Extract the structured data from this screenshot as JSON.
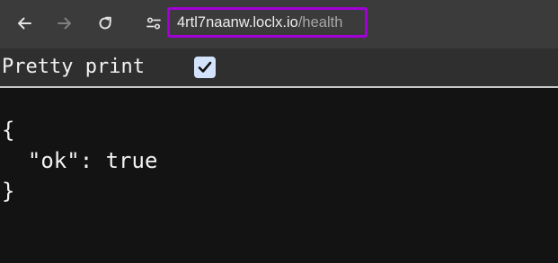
{
  "browser": {
    "url_host": "4rtl7naanw.loclx.io",
    "url_path": "/health",
    "back_icon": "arrow-left",
    "forward_icon": "arrow-right",
    "reload_icon": "reload",
    "site_info_icon": "tune-sliders"
  },
  "viewer": {
    "pretty_print_label": "Pretty print",
    "pretty_print_checked": true,
    "json_text": "{\n  \"ok\": true\n}"
  },
  "colors": {
    "toolbar_bg": "#3b3b3b",
    "page_bg": "#131313",
    "urlbar_highlight": "#a200d6",
    "checkbox_bg": "#d4e3fc"
  }
}
